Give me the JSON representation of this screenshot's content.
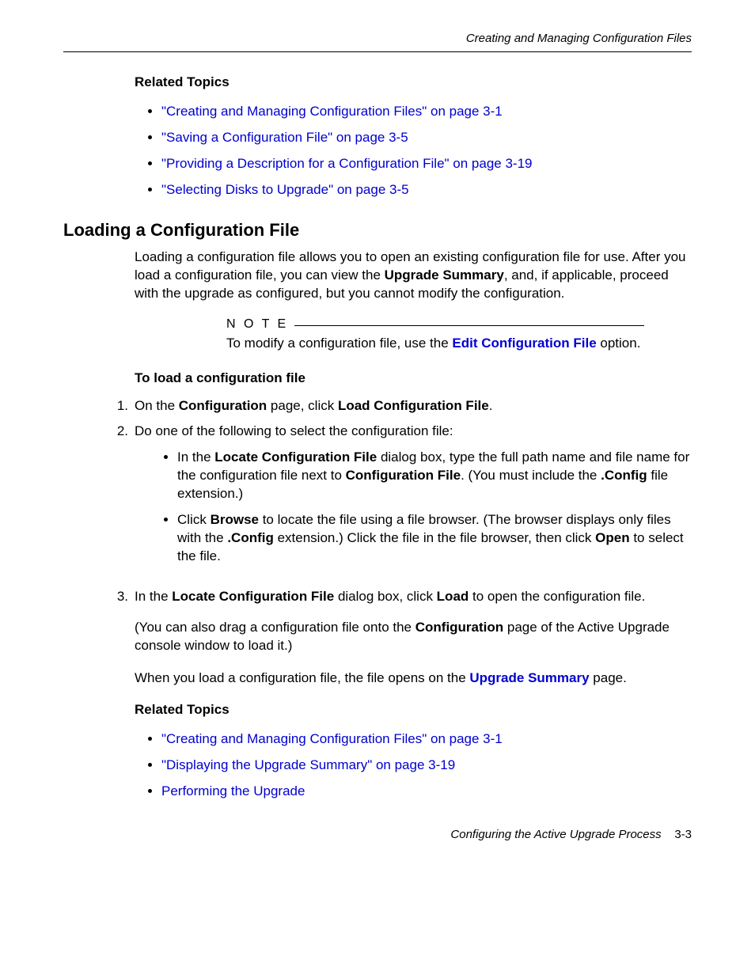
{
  "header": {
    "running_title": "Creating and Managing Configuration Files"
  },
  "related1": {
    "heading": "Related Topics",
    "items": [
      "\"Creating and Managing Configuration Files\" on page 3-1",
      "\"Saving a Configuration File\" on page 3-5",
      "\"Providing a Description for a Configuration File\" on page 3-19",
      "\"Selecting Disks to Upgrade\" on page 3-5"
    ]
  },
  "section": {
    "heading": "Loading a Configuration File",
    "para_before": "Loading a configuration file allows you to open an existing configuration file for use. After you load a configuration file, you can view the ",
    "para_bold1": "Upgrade Summary",
    "para_after": ", and, if applicable, proceed with the upgrade as configured, but you cannot modify the configuration."
  },
  "note": {
    "label": "N O T E",
    "text_before": "To modify a configuration file, use the ",
    "link": "Edit Configuration File",
    "text_after": " option."
  },
  "procedure": {
    "heading": "To load a configuration file",
    "step1_before": "On the ",
    "step1_bold1": "Configuration",
    "step1_mid": " page, click ",
    "step1_bold2": "Load Configuration File",
    "step1_after": ".",
    "step2": "Do one of the following to select the configuration file:",
    "sub_a_before": "In the ",
    "sub_a_bold1": "Locate Configuration File",
    "sub_a_mid1": " dialog box, type the full path name and file name for the configuration file next to ",
    "sub_a_bold2": "Configuration File",
    "sub_a_mid2": ". (You must include the ",
    "sub_a_bold3": ".Config",
    "sub_a_after": " file extension.)",
    "sub_b_before": "Click ",
    "sub_b_bold1": "Browse",
    "sub_b_mid1": " to locate the file using a file browser. (The browser displays only files with the ",
    "sub_b_bold2": ".Config",
    "sub_b_mid2": " extension.) Click the file in the file browser, then click ",
    "sub_b_bold3": "Open",
    "sub_b_after": " to select the file.",
    "step3_before": "In the ",
    "step3_bold1": "Locate Configuration File",
    "step3_mid": " dialog box, click ",
    "step3_bold2": "Load",
    "step3_after": " to open the configuration file."
  },
  "para2_before": "(You can also drag a configuration file onto the ",
  "para2_bold": "Configuration",
  "para2_after": " page of the Active Upgrade console window to load it.)",
  "para3_before": "When you load a configuration file, the file opens on the ",
  "para3_link": "Upgrade Summary",
  "para3_after": " page.",
  "related2": {
    "heading": "Related Topics",
    "items": [
      "\"Creating and Managing Configuration Files\" on page 3-1",
      "\"Displaying the Upgrade Summary\" on page 3-19",
      "Performing the Upgrade"
    ]
  },
  "footer": {
    "title": "Configuring the Active Upgrade Process",
    "page": "3-3"
  }
}
